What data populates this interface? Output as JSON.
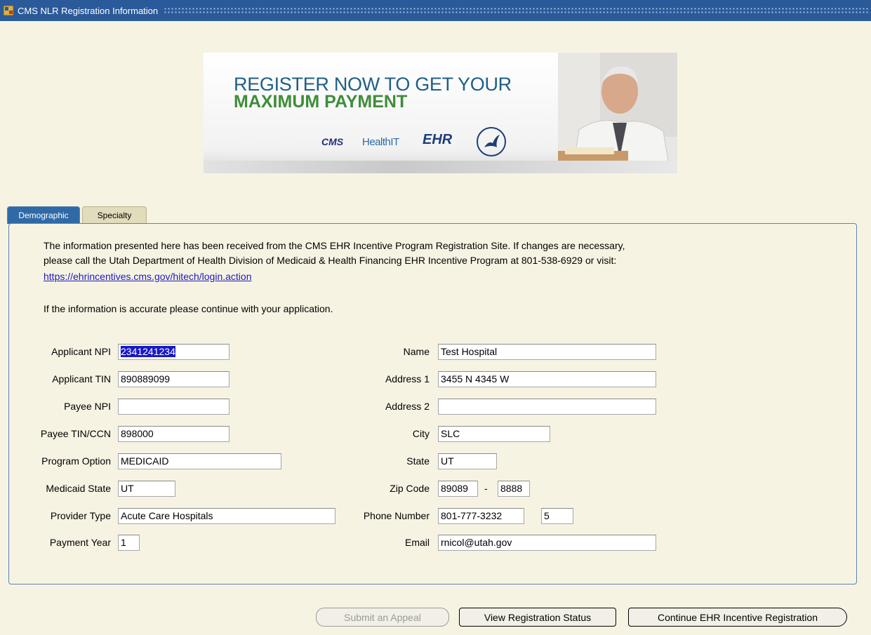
{
  "window": {
    "title": "CMS NLR Registration Information"
  },
  "banner": {
    "line1": "REGISTER NOW TO GET YOUR",
    "line2": "MAXIMUM PAYMENT",
    "logo_cms": "CMS",
    "logo_healthit": "HealthIT",
    "logo_ehr": "EHR"
  },
  "tabs": [
    {
      "label": "Demographic",
      "active": true
    },
    {
      "label": "Specialty",
      "active": false
    }
  ],
  "info": {
    "line1": "The information presented here has been received from the CMS EHR Incentive Program Registration Site.  If changes are necessary,",
    "line2": "please call the Utah Department of Health Division of Medicaid & Health Financing EHR Incentive Program at 801-538-6929 or visit:",
    "link": "https://ehrincentives.cms.gov/hitech/login.action",
    "line3": "If the information is accurate please continue with your application."
  },
  "left_fields": {
    "applicant_npi": {
      "label": "Applicant NPI",
      "value": "2341241234"
    },
    "applicant_tin": {
      "label": "Applicant TIN",
      "value": "890889099"
    },
    "payee_npi": {
      "label": "Payee NPI",
      "value": ""
    },
    "payee_tin_ccn": {
      "label": "Payee TIN/CCN",
      "value": "898000"
    },
    "program_option": {
      "label": "Program Option",
      "value": "MEDICAID"
    },
    "medicaid_state": {
      "label": "Medicaid State",
      "value": "UT"
    },
    "provider_type": {
      "label": "Provider Type",
      "value": "Acute Care Hospitals"
    },
    "payment_year": {
      "label": "Payment Year",
      "value": "1"
    }
  },
  "right_fields": {
    "name": {
      "label": "Name",
      "value": "Test Hospital"
    },
    "address1": {
      "label": "Address 1",
      "value": "3455 N 4345 W"
    },
    "address2": {
      "label": "Address 2",
      "value": ""
    },
    "city": {
      "label": "City",
      "value": "SLC"
    },
    "state": {
      "label": "State",
      "value": "UT"
    },
    "zip": {
      "label": "Zip Code",
      "value": "89089",
      "ext": "8888",
      "separator": "-"
    },
    "phone": {
      "label": "Phone Number",
      "value": "801-777-3232",
      "ext": "5"
    },
    "email": {
      "label": "Email",
      "value": "rnicol@utah.gov"
    }
  },
  "buttons": {
    "appeal": "Submit an Appeal",
    "view_status": "View Registration Status",
    "continue": "Continue EHR Incentive Registration"
  },
  "colors": {
    "titlebar": "#2a5a9a",
    "background": "#f7f3e3",
    "active_tab": "#2f6aa6",
    "selection": "#1818c8"
  }
}
